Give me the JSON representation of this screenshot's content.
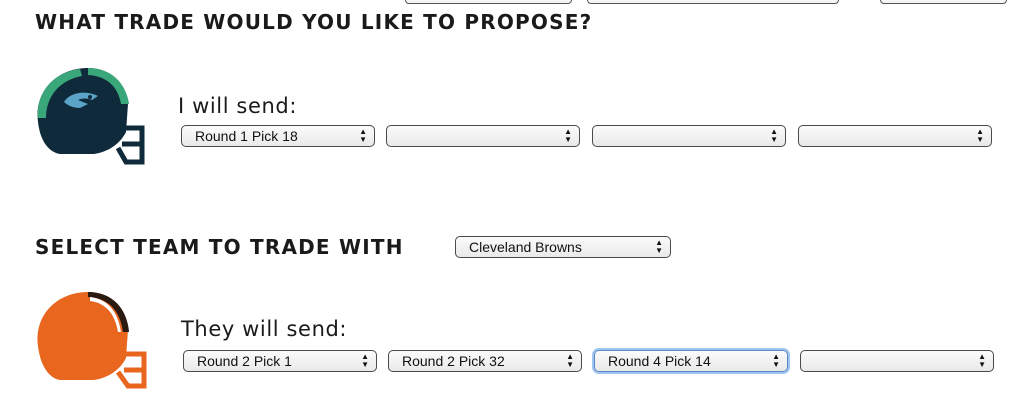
{
  "propose": {
    "title": "WHAT TRADE WOULD YOU LIKE TO PROPOSE?",
    "send_label": "I will send:",
    "send_picks": [
      "Round 1 Pick 18",
      "",
      "",
      ""
    ],
    "helmet_icon": "seattle-helmet-icon"
  },
  "partner": {
    "title": "SELECT TEAM TO TRADE WITH",
    "team_selected": "Cleveland Browns",
    "receive_label": "They will send:",
    "receive_picks": [
      "Round 2 Pick 1",
      "Round 2 Pick 32",
      "Round 4 Pick 14",
      ""
    ],
    "helmet_icon": "cleveland-helmet-icon"
  },
  "colors": {
    "seattle_navy": "#0f2a3a",
    "seattle_green": "#3aa77a",
    "cleveland_orange": "#e8661e",
    "cleveland_brown": "#2a1a10"
  }
}
